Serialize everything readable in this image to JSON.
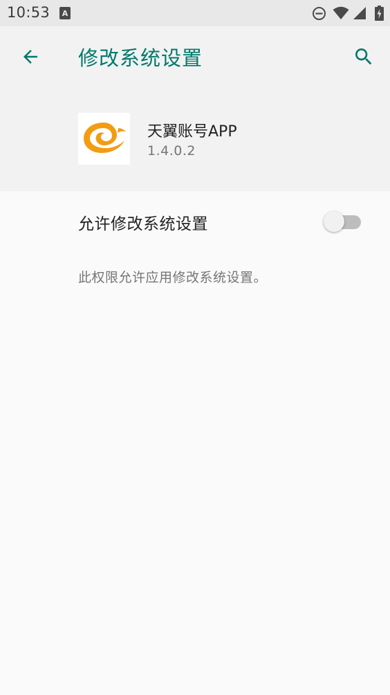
{
  "status_bar": {
    "time": "10:53",
    "icons": [
      "notification-a-icon",
      "do-not-disturb-icon",
      "wifi-icon",
      "cell-signal-icon",
      "battery-charging-icon"
    ]
  },
  "toolbar": {
    "title": "修改系统设置",
    "back_icon": "arrow-left-icon",
    "search_icon": "search-icon",
    "accent_color": "#00796b"
  },
  "app": {
    "name": "天翼账号APP",
    "version": "1.4.0.2",
    "icon": "swirl-logo-icon",
    "logo_color": "#f39c12"
  },
  "setting": {
    "label": "允许修改系统设置",
    "enabled": false
  },
  "description": "此权限允许应用修改系统设置。"
}
